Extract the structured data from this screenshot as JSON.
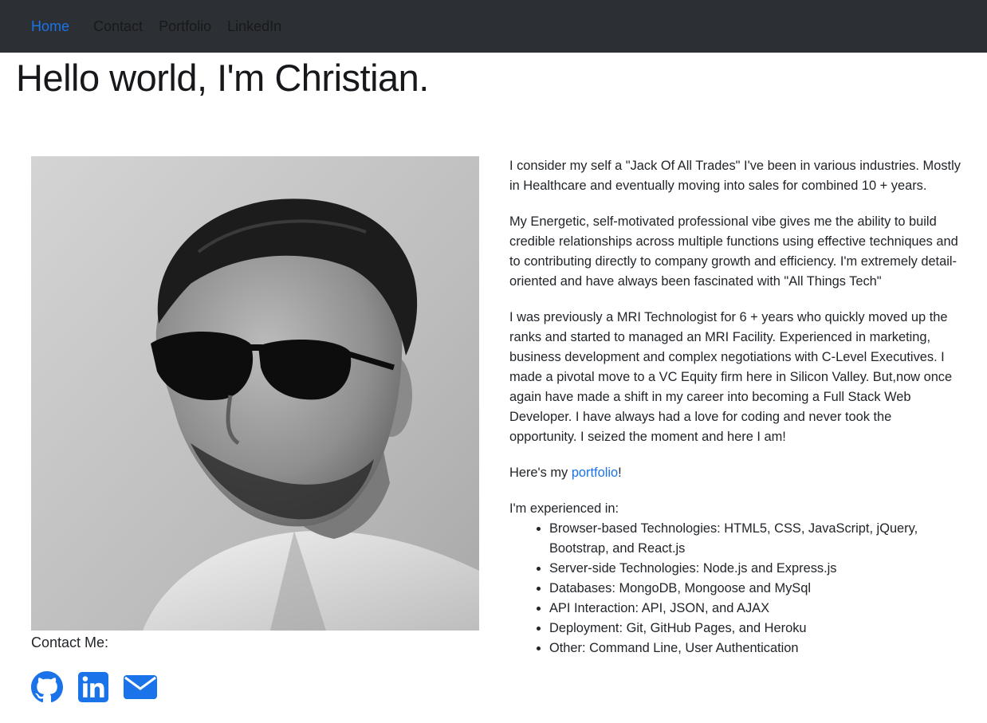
{
  "nav": {
    "items": [
      {
        "label": "Home",
        "active": true
      },
      {
        "label": "Contact",
        "active": false
      },
      {
        "label": "Portfolio",
        "active": false
      },
      {
        "label": "LinkedIn",
        "active": false
      }
    ]
  },
  "hero": {
    "title": "Hello world, I'm Christian."
  },
  "contact": {
    "label": "Contact Me:",
    "icons": [
      "github-icon",
      "linkedin-icon",
      "envelope-icon"
    ]
  },
  "bio": {
    "p1": "I consider my self a \"Jack Of All Trades\" I've been in various industries. Mostly in Healthcare and eventually moving into sales for combined 10 + years.",
    "p2": "My Energetic, self-motivated professional vibe gives me the ability to build credible relationships across multiple functions using effective techniques and to contributing directly to company growth and efficiency. I'm extremely detail-oriented and have always been fascinated with \"All Things Tech\"",
    "p3": "I was previously a MRI Technologist for 6 + years who quickly moved up the ranks and started to managed an MRI Facility. Experienced in marketing, business development and complex negotiations with C-Level Executives. I made a pivotal move to a VC Equity firm here in Silicon Valley. But,now once again have made a shift in my career into becoming a Full Stack Web Developer. I have always had a love for coding and never took the opportunity. I seized the moment and here I am!",
    "portfolio_prefix": "Here's my ",
    "portfolio_link": "portfolio",
    "portfolio_suffix": "!",
    "experience_label": "I'm experienced in:",
    "experience": [
      "Browser-based Technologies: HTML5, CSS, JavaScript, jQuery, Bootstrap, and React.js",
      "Server-side Technologies: Node.js and Express.js",
      "Databases: MongoDB, Mongoose and MySql",
      "API Interaction: API, JSON, and AJAX",
      "Deployment: Git, GitHub Pages, and Heroku",
      "Other: Command Line, User Authentication"
    ]
  },
  "colors": {
    "navbar_bg": "#2c2f33",
    "link_blue": "#1a73e8",
    "text": "#212529"
  }
}
